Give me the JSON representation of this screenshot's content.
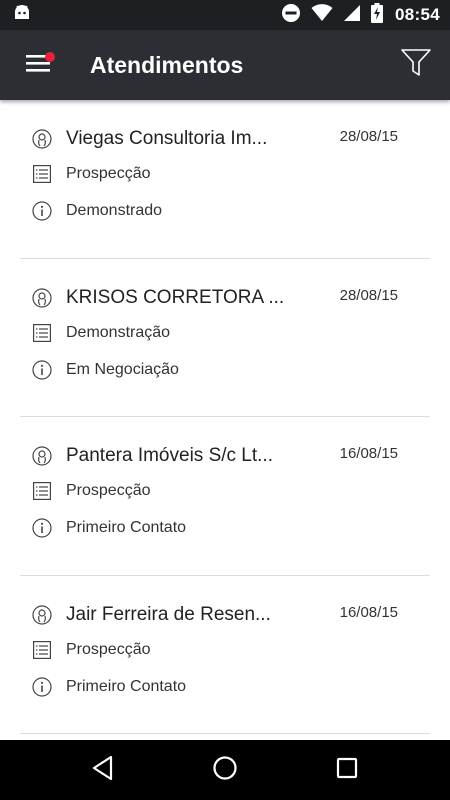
{
  "status_bar": {
    "time": "08:54",
    "icons": [
      "android-debug-icon",
      "do-not-disturb-icon",
      "wifi-icon",
      "signal-icon",
      "battery-charging-icon"
    ]
  },
  "app_bar": {
    "title": "Atendimentos",
    "menu_icon": "hamburger-menu-icon",
    "filter_icon": "filter-funnel-icon",
    "badge_color": "#e8223a"
  },
  "items": [
    {
      "name": "Viegas Consultoria Im...",
      "date": "28/08/15",
      "stage": "Prospecção",
      "status": "Demonstrado"
    },
    {
      "name": "KRISOS CORRETORA ...",
      "date": "28/08/15",
      "stage": "Demonstração",
      "status": "Em Negociação"
    },
    {
      "name": "Pantera Imóveis S/c Lt...",
      "date": "16/08/15",
      "stage": "Prospecção",
      "status": "Primeiro Contato"
    },
    {
      "name": "Jair Ferreira de Resen...",
      "date": "16/08/15",
      "stage": "Prospecção",
      "status": "Primeiro Contato"
    }
  ],
  "nav_bar": {
    "icons": [
      "back-icon",
      "home-icon",
      "recents-icon"
    ]
  },
  "colors": {
    "status_bar": "#1d2023",
    "app_bar": "#2b2f33",
    "nav_bar": "#000000"
  }
}
